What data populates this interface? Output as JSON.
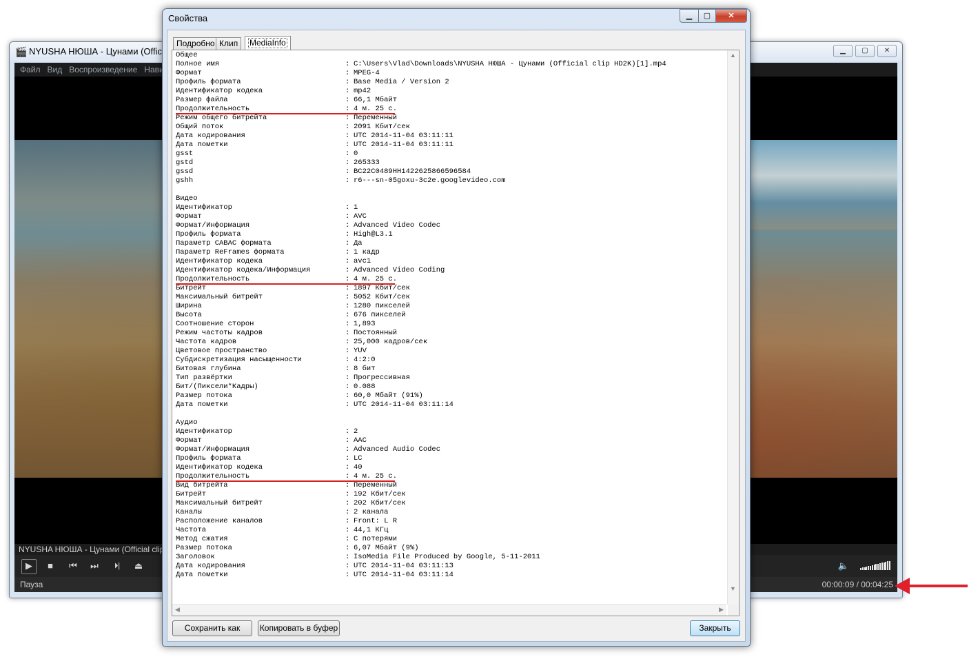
{
  "player": {
    "title": "NYUSHA  НЮША - Цунами (Official clip HD2K)[1].mp4",
    "menu": [
      "Файл",
      "Вид",
      "Воспроизведение",
      "Навигация"
    ],
    "caption": "NYUSHA  НЮША - Цунами (Official clip HD2K)[1].mp4",
    "status_left": "Пауза",
    "status_right": "00:00:09 / 00:04:25",
    "controls": {
      "play": "▶",
      "stop": "■",
      "prev": "⏮",
      "next": "⏭",
      "frame_step": "⏵|",
      "eject": "⏏",
      "volume": "🔈"
    },
    "volume_level": 1.0
  },
  "dialog": {
    "title": "Свойства",
    "tabs": [
      "Подробно",
      "Клип",
      "MediaInfo"
    ],
    "active_tab": "MediaInfo",
    "buttons": {
      "save": "Сохранить как",
      "copy": "Копировать в буфер",
      "close": "Закрыть"
    },
    "sections": [
      {
        "title": "Общее",
        "rows": [
          [
            "Полное имя",
            "C:\\Users\\Vlad\\Downloads\\NYUSHA  НЮША - Цунами (Official clip HD2K)[1].mp4"
          ],
          [
            "Формат",
            "MPEG-4"
          ],
          [
            "Профиль формата",
            "Base Media / Version 2"
          ],
          [
            "Идентификатор кодека",
            "mp42"
          ],
          [
            "Размер файла",
            "66,1 Мбайт"
          ],
          [
            "Продолжительность",
            "4 м. 25 с."
          ],
          [
            "Режим общего битрейта",
            "Переменный"
          ],
          [
            "Общий поток",
            "2091 Кбит/сек"
          ],
          [
            "Дата кодирования",
            "UTC 2014-11-04 03:11:11"
          ],
          [
            "Дата пометки",
            "UTC 2014-11-04 03:11:11"
          ],
          [
            "gsst",
            "0"
          ],
          [
            "gstd",
            "265333"
          ],
          [
            "gssd",
            "BC22C0489HH1422625866596584"
          ],
          [
            "gshh",
            "r6---sn-05goxu-3c2e.googlevideo.com"
          ]
        ]
      },
      {
        "title": "Видео",
        "rows": [
          [
            "Идентификатор",
            "1"
          ],
          [
            "Формат",
            "AVC"
          ],
          [
            "Формат/Информация",
            "Advanced Video Codec"
          ],
          [
            "Профиль формата",
            "High@L3.1"
          ],
          [
            "Параметр CABAC формата",
            "Да"
          ],
          [
            "Параметр ReFrames формата",
            "1 кадр"
          ],
          [
            "Идентификатор кодека",
            "avc1"
          ],
          [
            "Идентификатор кодека/Информация",
            "Advanced Video Coding"
          ],
          [
            "Продолжительность",
            "4 м. 25 с."
          ],
          [
            "Битрейт",
            "1897 Кбит/сек"
          ],
          [
            "Максимальный битрейт",
            "5052 Кбит/сек"
          ],
          [
            "Ширина",
            "1280 пикселей"
          ],
          [
            "Высота",
            "676 пикселей"
          ],
          [
            "Соотношение сторон",
            "1,893"
          ],
          [
            "Режим частоты кадров",
            "Постоянный"
          ],
          [
            "Частота кадров",
            "25,000 кадров/сек"
          ],
          [
            "Цветовое пространство",
            "YUV"
          ],
          [
            "Субдискретизация насыщенности",
            "4:2:0"
          ],
          [
            "Битовая глубина",
            "8 бит"
          ],
          [
            "Тип развёртки",
            "Прогрессивная"
          ],
          [
            "Бит/(Пиксели*Кадры)",
            "0.088"
          ],
          [
            "Размер потока",
            "60,0 Мбайт (91%)"
          ],
          [
            "Дата пометки",
            "UTC 2014-11-04 03:11:14"
          ]
        ]
      },
      {
        "title": "Аудио",
        "rows": [
          [
            "Идентификатор",
            "2"
          ],
          [
            "Формат",
            "AAC"
          ],
          [
            "Формат/Информация",
            "Advanced Audio Codec"
          ],
          [
            "Профиль формата",
            "LC"
          ],
          [
            "Идентификатор кодека",
            "40"
          ],
          [
            "Продолжительность",
            "4 м. 25 с."
          ],
          [
            "Вид битрейта",
            "Переменный"
          ],
          [
            "Битрейт",
            "192 Кбит/сек"
          ],
          [
            "Максимальный битрейт",
            "202 Кбит/сек"
          ],
          [
            "Каналы",
            "2 канала"
          ],
          [
            "Расположение каналов",
            "Front: L R"
          ],
          [
            "Частота",
            "44,1 КГц"
          ],
          [
            "Метод сжатия",
            "С потерями"
          ],
          [
            "Размер потока",
            "6,07 Мбайт (9%)"
          ],
          [
            "Заголовок",
            "IsoMedia File Produced by Google, 5-11-2011"
          ],
          [
            "Дата кодирования",
            "UTC 2014-11-04 03:11:13"
          ],
          [
            "Дата пометки",
            "UTC 2014-11-04 03:11:14"
          ]
        ]
      }
    ],
    "highlight_key": "Продолжительность",
    "highlight_color": "#d42020"
  },
  "annotation_arrow_color": "#e0202a"
}
